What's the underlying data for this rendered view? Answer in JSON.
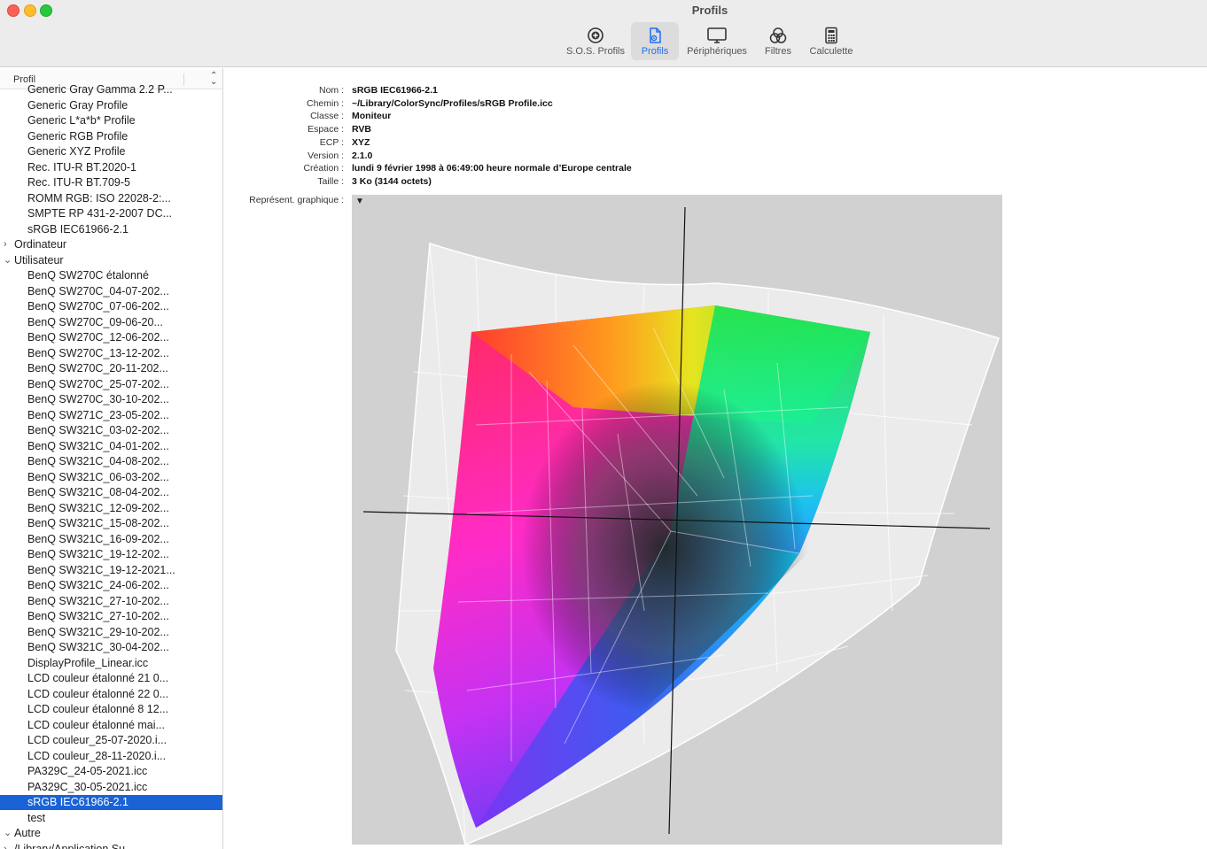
{
  "window": {
    "title": "Profils"
  },
  "toolbar": {
    "items": [
      {
        "label": "S.O.S. Profils",
        "icon": "plus-circle-icon",
        "active": false
      },
      {
        "label": "Profils",
        "icon": "profile-document-icon",
        "active": true
      },
      {
        "label": "Périphériques",
        "icon": "monitor-icon",
        "active": false
      },
      {
        "label": "Filtres",
        "icon": "filters-icon",
        "active": false
      },
      {
        "label": "Calculette",
        "icon": "calculator-icon",
        "active": false
      }
    ]
  },
  "sidebar": {
    "column_header": "Profil",
    "rows": [
      {
        "text": "Generic Gray Gamma 2.2 P...",
        "type": "child"
      },
      {
        "text": "Generic Gray Profile",
        "type": "child"
      },
      {
        "text": "Generic L*a*b* Profile",
        "type": "child"
      },
      {
        "text": "Generic RGB Profile",
        "type": "child"
      },
      {
        "text": "Generic XYZ Profile",
        "type": "child"
      },
      {
        "text": "Rec. ITU-R BT.2020-1",
        "type": "child"
      },
      {
        "text": "Rec. ITU-R BT.709-5",
        "type": "child"
      },
      {
        "text": "ROMM RGB: ISO 22028-2:...",
        "type": "child"
      },
      {
        "text": "SMPTE RP 431-2-2007 DC...",
        "type": "child"
      },
      {
        "text": "sRGB IEC61966-2.1",
        "type": "child"
      },
      {
        "text": "Ordinateur",
        "type": "group",
        "expanded": false
      },
      {
        "text": "Utilisateur",
        "type": "group",
        "expanded": true
      },
      {
        "text": "BenQ SW270C étalonné",
        "type": "child"
      },
      {
        "text": "BenQ SW270C_04-07-202...",
        "type": "child"
      },
      {
        "text": "BenQ SW270C_07-06-202...",
        "type": "child"
      },
      {
        "text": "BenQ SW270C_09-06-20...",
        "type": "child"
      },
      {
        "text": "BenQ SW270C_12-06-202...",
        "type": "child"
      },
      {
        "text": "BenQ SW270C_13-12-202...",
        "type": "child"
      },
      {
        "text": "BenQ SW270C_20-11-202...",
        "type": "child"
      },
      {
        "text": "BenQ SW270C_25-07-202...",
        "type": "child"
      },
      {
        "text": "BenQ SW270C_30-10-202...",
        "type": "child"
      },
      {
        "text": "BenQ SW271C_23-05-202...",
        "type": "child"
      },
      {
        "text": "BenQ SW321C_03-02-202...",
        "type": "child"
      },
      {
        "text": "BenQ SW321C_04-01-202...",
        "type": "child"
      },
      {
        "text": "BenQ SW321C_04-08-202...",
        "type": "child"
      },
      {
        "text": "BenQ SW321C_06-03-202...",
        "type": "child"
      },
      {
        "text": "BenQ SW321C_08-04-202...",
        "type": "child"
      },
      {
        "text": "BenQ SW321C_12-09-202...",
        "type": "child"
      },
      {
        "text": "BenQ SW321C_15-08-202...",
        "type": "child"
      },
      {
        "text": "BenQ SW321C_16-09-202...",
        "type": "child"
      },
      {
        "text": "BenQ SW321C_19-12-202...",
        "type": "child"
      },
      {
        "text": "BenQ SW321C_19-12-2021...",
        "type": "child"
      },
      {
        "text": "BenQ SW321C_24-06-202...",
        "type": "child"
      },
      {
        "text": "BenQ SW321C_27-10-202...",
        "type": "child"
      },
      {
        "text": "BenQ SW321C_27-10-202...",
        "type": "child"
      },
      {
        "text": "BenQ SW321C_29-10-202...",
        "type": "child"
      },
      {
        "text": "BenQ SW321C_30-04-202...",
        "type": "child"
      },
      {
        "text": "DisplayProfile_Linear.icc",
        "type": "child"
      },
      {
        "text": "LCD couleur étalonné 21 0...",
        "type": "child"
      },
      {
        "text": "LCD couleur étalonné 22 0...",
        "type": "child"
      },
      {
        "text": "LCD couleur étalonné 8 12...",
        "type": "child"
      },
      {
        "text": "LCD couleur étalonné mai...",
        "type": "child"
      },
      {
        "text": "LCD couleur_25-07-2020.i...",
        "type": "child"
      },
      {
        "text": "LCD couleur_28-11-2020.i...",
        "type": "child"
      },
      {
        "text": "PA329C_24-05-2021.icc",
        "type": "child"
      },
      {
        "text": "PA329C_30-05-2021.icc",
        "type": "child"
      },
      {
        "text": "sRGB IEC61966-2.1",
        "type": "child",
        "selected": true
      },
      {
        "text": "test",
        "type": "child"
      },
      {
        "text": "Autre",
        "type": "group",
        "expanded": true
      },
      {
        "text": "/Library/Application Su...",
        "type": "group",
        "expanded": false
      }
    ]
  },
  "profile": {
    "fields": [
      {
        "label": "Nom :",
        "value": "sRGB IEC61966-2.1"
      },
      {
        "label": "Chemin :",
        "value": "~/Library/ColorSync/Profiles/sRGB Profile.icc"
      },
      {
        "label": "Classe :",
        "value": "Moniteur"
      },
      {
        "label": "Espace :",
        "value": "RVB"
      },
      {
        "label": "ECP :",
        "value": "XYZ"
      },
      {
        "label": "Version :",
        "value": "2.1.0"
      },
      {
        "label": "Création :",
        "value": "lundi 9 février 1998 à 06:49:00 heure normale d’Europe centrale"
      },
      {
        "label": "Taille :",
        "value": "3 Ko (3144 octets)"
      }
    ],
    "graph_label": "Représent. graphique :",
    "graph_toggle": "▼"
  },
  "colors": {
    "accent": "#1a63d6",
    "graph_bg": "#d1d1d1",
    "toolbar_bg": "#ececec"
  }
}
